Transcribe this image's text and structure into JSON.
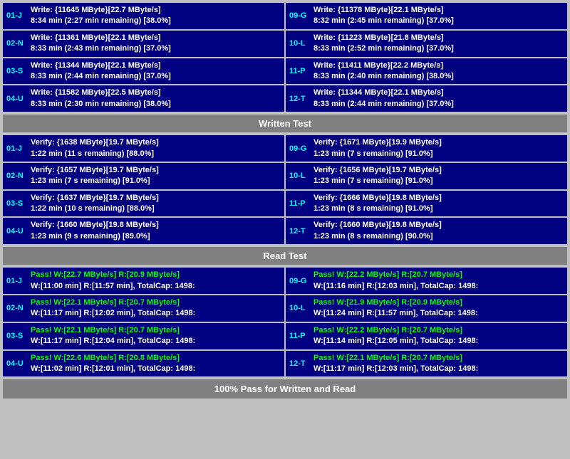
{
  "sections": {
    "write": {
      "rows": [
        {
          "left": {
            "id": "01-J",
            "line1": "Write: {11645 MByte}[22.7 MByte/s]",
            "line2": "8:34 min (2:27 min remaining)  [38.0%]"
          },
          "right": {
            "id": "09-G",
            "line1": "Write: {11378 MByte}[22.1 MByte/s]",
            "line2": "8:32 min (2:45 min remaining)  [37.0%]"
          }
        },
        {
          "left": {
            "id": "02-N",
            "line1": "Write: {11361 MByte}[22.1 MByte/s]",
            "line2": "8:33 min (2:43 min remaining)  [37.0%]"
          },
          "right": {
            "id": "10-L",
            "line1": "Write: {11223 MByte}[21.8 MByte/s]",
            "line2": "8:33 min (2:52 min remaining)  [37.0%]"
          }
        },
        {
          "left": {
            "id": "03-S",
            "line1": "Write: {11344 MByte}[22.1 MByte/s]",
            "line2": "8:33 min (2:44 min remaining)  [37.0%]"
          },
          "right": {
            "id": "11-P",
            "line1": "Write: {11411 MByte}[22.2 MByte/s]",
            "line2": "8:33 min (2:40 min remaining)  [38.0%]"
          }
        },
        {
          "left": {
            "id": "04-U",
            "line1": "Write: {11582 MByte}[22.5 MByte/s]",
            "line2": "8:33 min (2:30 min remaining)  [38.0%]"
          },
          "right": {
            "id": "12-T",
            "line1": "Write: {11344 MByte}[22.1 MByte/s]",
            "line2": "8:33 min (2:44 min remaining)  [37.0%]"
          }
        }
      ],
      "header": "Written Test"
    },
    "verify": {
      "rows": [
        {
          "left": {
            "id": "01-J",
            "line1": "Verify: {1638 MByte}[19.7 MByte/s]",
            "line2": "1:22 min (11 s remaining)  [88.0%]"
          },
          "right": {
            "id": "09-G",
            "line1": "Verify: {1671 MByte}[19.9 MByte/s]",
            "line2": "1:23 min (7 s remaining)  [91.0%]"
          }
        },
        {
          "left": {
            "id": "02-N",
            "line1": "Verify: {1657 MByte}[19.7 MByte/s]",
            "line2": "1:23 min (7 s remaining)  [91.0%]"
          },
          "right": {
            "id": "10-L",
            "line1": "Verify: {1656 MByte}[19.7 MByte/s]",
            "line2": "1:23 min (7 s remaining)  [91.0%]"
          }
        },
        {
          "left": {
            "id": "03-S",
            "line1": "Verify: {1637 MByte}[19.7 MByte/s]",
            "line2": "1:22 min (10 s remaining)  [88.0%]"
          },
          "right": {
            "id": "11-P",
            "line1": "Verify: {1666 MByte}[19.8 MByte/s]",
            "line2": "1:23 min (8 s remaining)  [91.0%]"
          }
        },
        {
          "left": {
            "id": "04-U",
            "line1": "Verify: {1660 MByte}[19.8 MByte/s]",
            "line2": "1:23 min (9 s remaining)  [89.0%]"
          },
          "right": {
            "id": "12-T",
            "line1": "Verify: {1660 MByte}[19.8 MByte/s]",
            "line2": "1:23 min (8 s remaining)  [90.0%]"
          }
        }
      ],
      "header": "Read Test"
    },
    "read": {
      "rows": [
        {
          "left": {
            "id": "01-J",
            "line1": "Pass! W:[22.7 MByte/s] R:[20.9 MByte/s]",
            "line2": "W:[11:00 min] R:[11:57 min], TotalCap: 1498:"
          },
          "right": {
            "id": "09-G",
            "line1": "Pass! W:[22.2 MByte/s] R:[20.7 MByte/s]",
            "line2": "W:[11:16 min] R:[12:03 min], TotalCap: 1498:"
          }
        },
        {
          "left": {
            "id": "02-N",
            "line1": "Pass! W:[22.1 MByte/s] R:[20.7 MByte/s]",
            "line2": "W:[11:17 min] R:[12:02 min], TotalCap: 1498:"
          },
          "right": {
            "id": "10-L",
            "line1": "Pass! W:[21.9 MByte/s] R:[20.9 MByte/s]",
            "line2": "W:[11:24 min] R:[11:57 min], TotalCap: 1498:"
          }
        },
        {
          "left": {
            "id": "03-S",
            "line1": "Pass! W:[22.1 MByte/s] R:[20.7 MByte/s]",
            "line2": "W:[11:17 min] R:[12:04 min], TotalCap: 1498:"
          },
          "right": {
            "id": "11-P",
            "line1": "Pass! W:[22.2 MByte/s] R:[20.7 MByte/s]",
            "line2": "W:[11:14 min] R:[12:05 min], TotalCap: 1498:"
          }
        },
        {
          "left": {
            "id": "04-U",
            "line1": "Pass! W:[22.6 MByte/s] R:[20.8 MByte/s]",
            "line2": "W:[11:02 min] R:[12:01 min], TotalCap: 1498:"
          },
          "right": {
            "id": "12-T",
            "line1": "Pass! W:[22.1 MByte/s] R:[20.7 MByte/s]",
            "line2": "W:[11:17 min] R:[12:03 min], TotalCap: 1498:"
          }
        }
      ]
    },
    "footer": "100% Pass for Written and Read"
  }
}
